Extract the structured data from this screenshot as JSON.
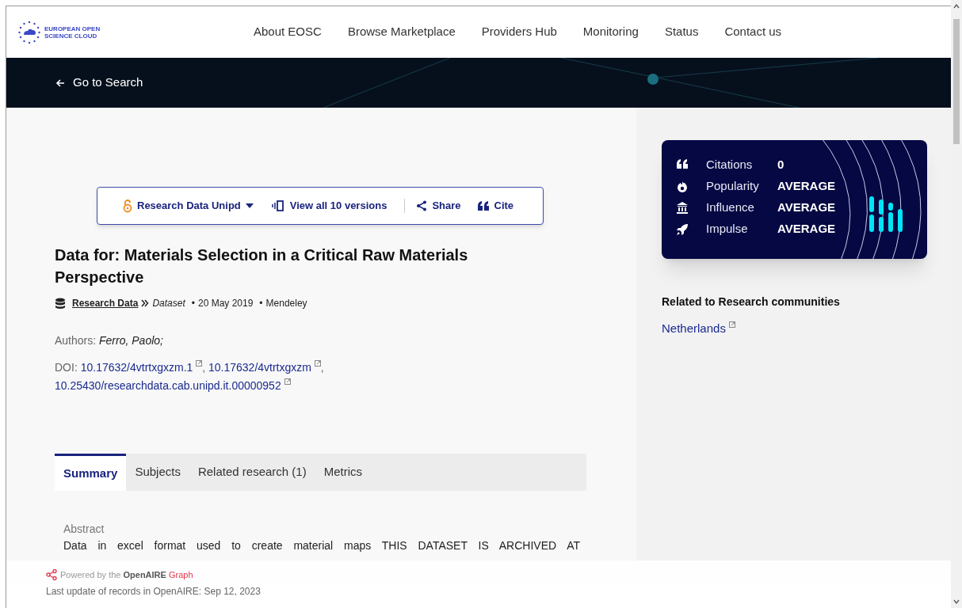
{
  "nav": {
    "logo_lines": [
      "EUROPEAN OPEN",
      "SCIENCE CLOUD"
    ],
    "links": [
      "About EOSC",
      "Browse Marketplace",
      "Providers Hub",
      "Monitoring",
      "Status",
      "Contact us"
    ]
  },
  "banner": {
    "back_link": "Go to Search"
  },
  "actions": [
    {
      "kind": "source",
      "label": "Research Data Unipd"
    },
    {
      "kind": "versions",
      "label": "View all 10 versions"
    },
    {
      "kind": "share",
      "label": "Share"
    },
    {
      "kind": "cite",
      "label": "Cite"
    }
  ],
  "title": "Data for: Materials Selection in a Critical Raw Materials Perspective",
  "meta": {
    "type": "Research Data",
    "subtype": "Dataset",
    "date": "20 May 2019",
    "publisher": "Mendeley",
    "separator": "•"
  },
  "authors": {
    "label": "Authors:",
    "value": "Ferro, Paolo;"
  },
  "doi": {
    "label": "DOI:",
    "separator": ",",
    "links": [
      "10.17632/4vtrtxgxzm.1",
      "10.17632/4vtrtxgxzm",
      "10.25430/researchdata.cab.unipd.it.00000952"
    ]
  },
  "tabs": [
    {
      "label": "Summary",
      "selected": true
    },
    {
      "label": "Subjects",
      "selected": false
    },
    {
      "label": "Related research (1)",
      "selected": false
    },
    {
      "label": "Metrics",
      "selected": false
    }
  ],
  "abstract": {
    "label": "Abstract",
    "text": "Data in excel format used to create material maps THIS DATASET IS ARCHIVED AT"
  },
  "footer": {
    "powered_by": "Powered by the",
    "brand": "OpenAIRE",
    "brand_suffix": "Graph",
    "last_update": "Last update of records in OpenAIRE: Sep 12, 2023"
  },
  "metrics": [
    {
      "kind": "citations",
      "label": "Citations",
      "value": "0"
    },
    {
      "kind": "popularity",
      "label": "Popularity",
      "value": "AVERAGE"
    },
    {
      "kind": "influence",
      "label": "Influence",
      "value": "AVERAGE"
    },
    {
      "kind": "impulse",
      "label": "Impulse",
      "value": "AVERAGE"
    }
  ],
  "communities": {
    "heading": "Related to Research communities",
    "items": [
      "Netherlands"
    ]
  }
}
